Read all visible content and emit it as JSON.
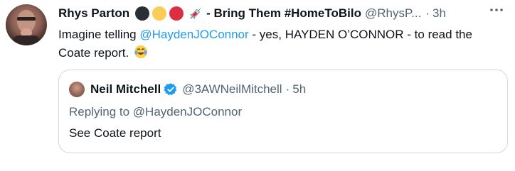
{
  "tweet": {
    "author_name": "Rhys Parton",
    "name_suffix": "- Bring Them #HomeToBilo",
    "handle": "@RhysP...",
    "separator": "·",
    "time": "3h",
    "text_before": "Imagine telling ",
    "mention": "@HaydenJOConnor",
    "text_after": " - yes, HAYDEN O’CONNOR - to read the Coate report.",
    "circle_colors": [
      "#292f33",
      "#fdcb58",
      "#dd2e44"
    ]
  },
  "quoted": {
    "author_name": "Neil Mitchell",
    "handle": "@3AWNeilMitchell",
    "separator": "·",
    "time": "5h",
    "replying_prefix": "Replying to ",
    "replying_to": "@HaydenJOConnor",
    "text": "See Coate report"
  },
  "colors": {
    "accent": "#1d9bf0",
    "secondary_text": "#536471",
    "border": "#cfd9de"
  }
}
